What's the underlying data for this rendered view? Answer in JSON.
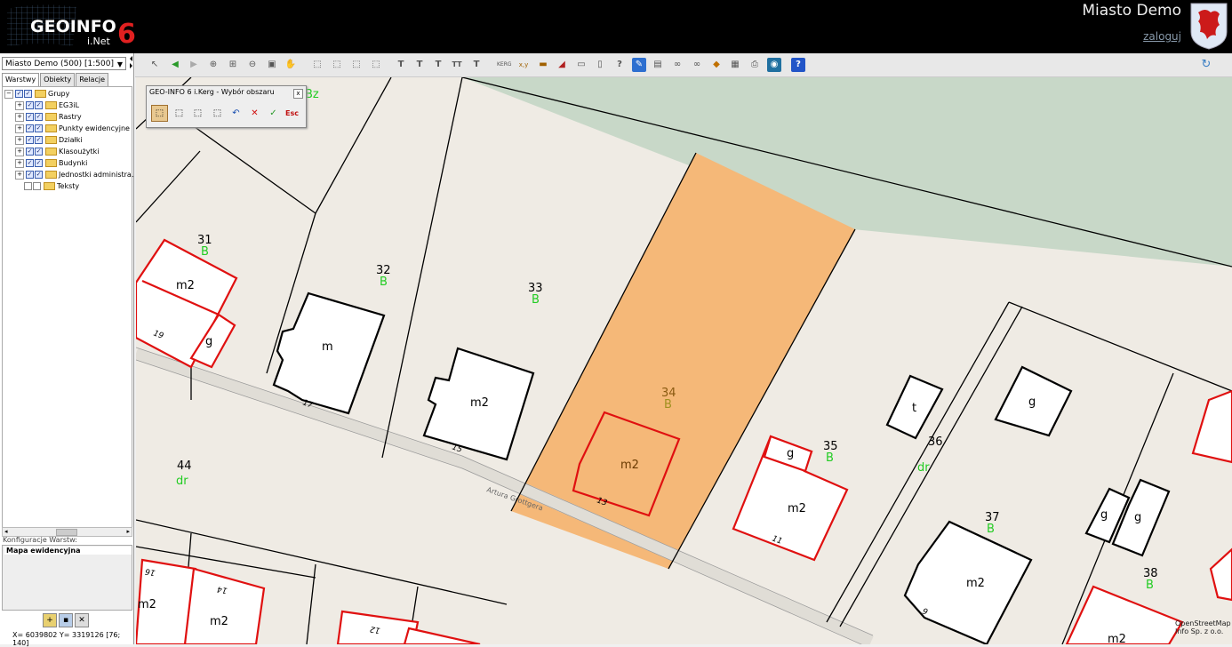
{
  "header": {
    "logo_text": "GEOINFO",
    "logo_sub": "i.Net",
    "logo_version": "6",
    "city": "Miasto Demo",
    "login": "zaloguj"
  },
  "left_panel": {
    "scale_select": "Miasto Demo (500) [1:500]",
    "tabs": [
      {
        "label": "Warstwy",
        "active": true
      },
      {
        "label": "Obiekty",
        "active": false
      },
      {
        "label": "Relacje",
        "active": false
      }
    ],
    "tree": [
      {
        "label": "Grupy",
        "level": 0,
        "checked": true
      },
      {
        "label": "EG3iL",
        "level": 1,
        "checked": true
      },
      {
        "label": "Rastry",
        "level": 1,
        "checked": true
      },
      {
        "label": "Punkty ewidencyjne",
        "level": 1,
        "checked": true
      },
      {
        "label": "Działki",
        "level": 1,
        "checked": true
      },
      {
        "label": "Klasoużytki",
        "level": 1,
        "checked": true
      },
      {
        "label": "Budynki",
        "level": 1,
        "checked": true
      },
      {
        "label": "Jednostki administra.",
        "level": 1,
        "checked": true
      },
      {
        "label": "Teksty",
        "level": 1,
        "checked": false
      }
    ],
    "config_label": "Konfiguracje Warstw:",
    "config_item": "Mapa ewidencyjna",
    "coords": "X= 6039802 Y= 3319126 [76; 140]"
  },
  "dialog": {
    "title": "GEO-INFO 6 i.Kerg - Wybór obszaru",
    "close": "x",
    "esc": "Esc"
  },
  "map": {
    "street": "Artura Grottgera",
    "attribution_line1": "OpenStreetMap",
    "attribution_line2": "Info Sp. z o.o.",
    "parcels": [
      {
        "num": "31",
        "cls": "B"
      },
      {
        "num": "32",
        "cls": "B"
      },
      {
        "num": "33",
        "cls": "B"
      },
      {
        "num": "34",
        "cls": "B"
      },
      {
        "num": "35",
        "cls": "B"
      },
      {
        "num": "36",
        "cls": "dr"
      },
      {
        "num": "37",
        "cls": "B"
      },
      {
        "num": "38",
        "cls": "B"
      },
      {
        "num": "44",
        "cls": "dr"
      }
    ],
    "top_fragment_cls": "Bz",
    "buildings": [
      "m2",
      "g",
      "m",
      "m2",
      "m2",
      "g",
      "m2",
      "t",
      "g",
      "g",
      "g",
      "m2",
      "m2",
      "m2",
      "m2"
    ],
    "house_numbers": [
      "19",
      "17",
      "15",
      "13",
      "11",
      "9",
      "16",
      "14",
      "12"
    ]
  }
}
